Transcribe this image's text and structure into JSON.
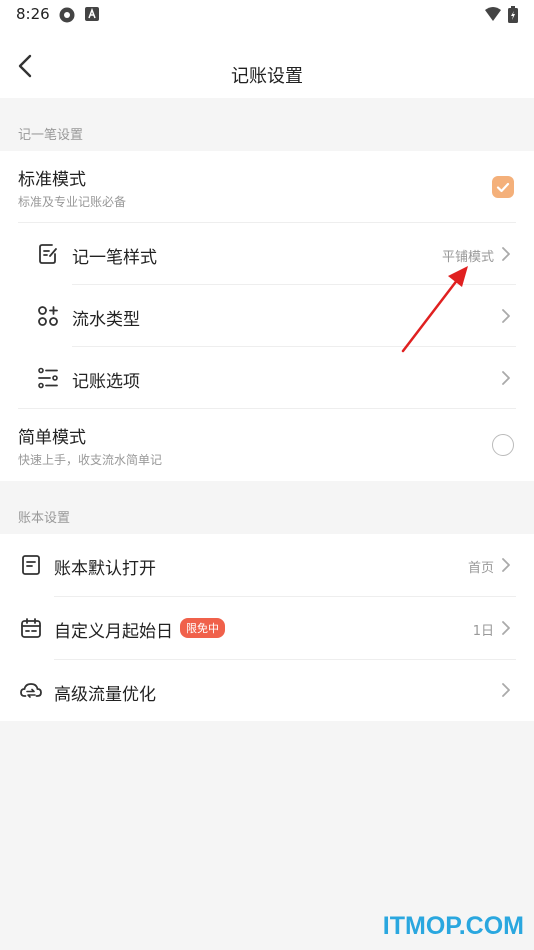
{
  "status_bar": {
    "time": "8:26"
  },
  "header": {
    "title": "记账设置"
  },
  "sections": {
    "record": {
      "label": "记一笔设置"
    },
    "book": {
      "label": "账本设置"
    }
  },
  "standard_mode": {
    "title": "标准模式",
    "subtitle": "标准及专业记账必备",
    "checked": true
  },
  "simple_mode": {
    "title": "简单模式",
    "subtitle": "快速上手，收支流水简单记",
    "checked": false
  },
  "record_items": [
    {
      "label": "记一笔样式",
      "value": "平铺模式",
      "icon": "edit-note-icon"
    },
    {
      "label": "流水类型",
      "value": "",
      "icon": "grid-add-icon"
    },
    {
      "label": "记账选项",
      "value": "",
      "icon": "sliders-icon"
    }
  ],
  "book_items": [
    {
      "label": "账本默认打开",
      "value": "首页",
      "icon": "document-icon"
    },
    {
      "label": "自定义月起始日",
      "value": "1日",
      "badge": "限免中",
      "icon": "calendar-icon"
    },
    {
      "label": "高级流量优化",
      "value": "",
      "icon": "cloud-sync-icon"
    }
  ],
  "watermark": "ITMOP.COM",
  "colors": {
    "accent_check": "#f4b07a",
    "badge": "#f0614b",
    "annotation_arrow": "#e02020",
    "watermark": "#2aa7df"
  }
}
